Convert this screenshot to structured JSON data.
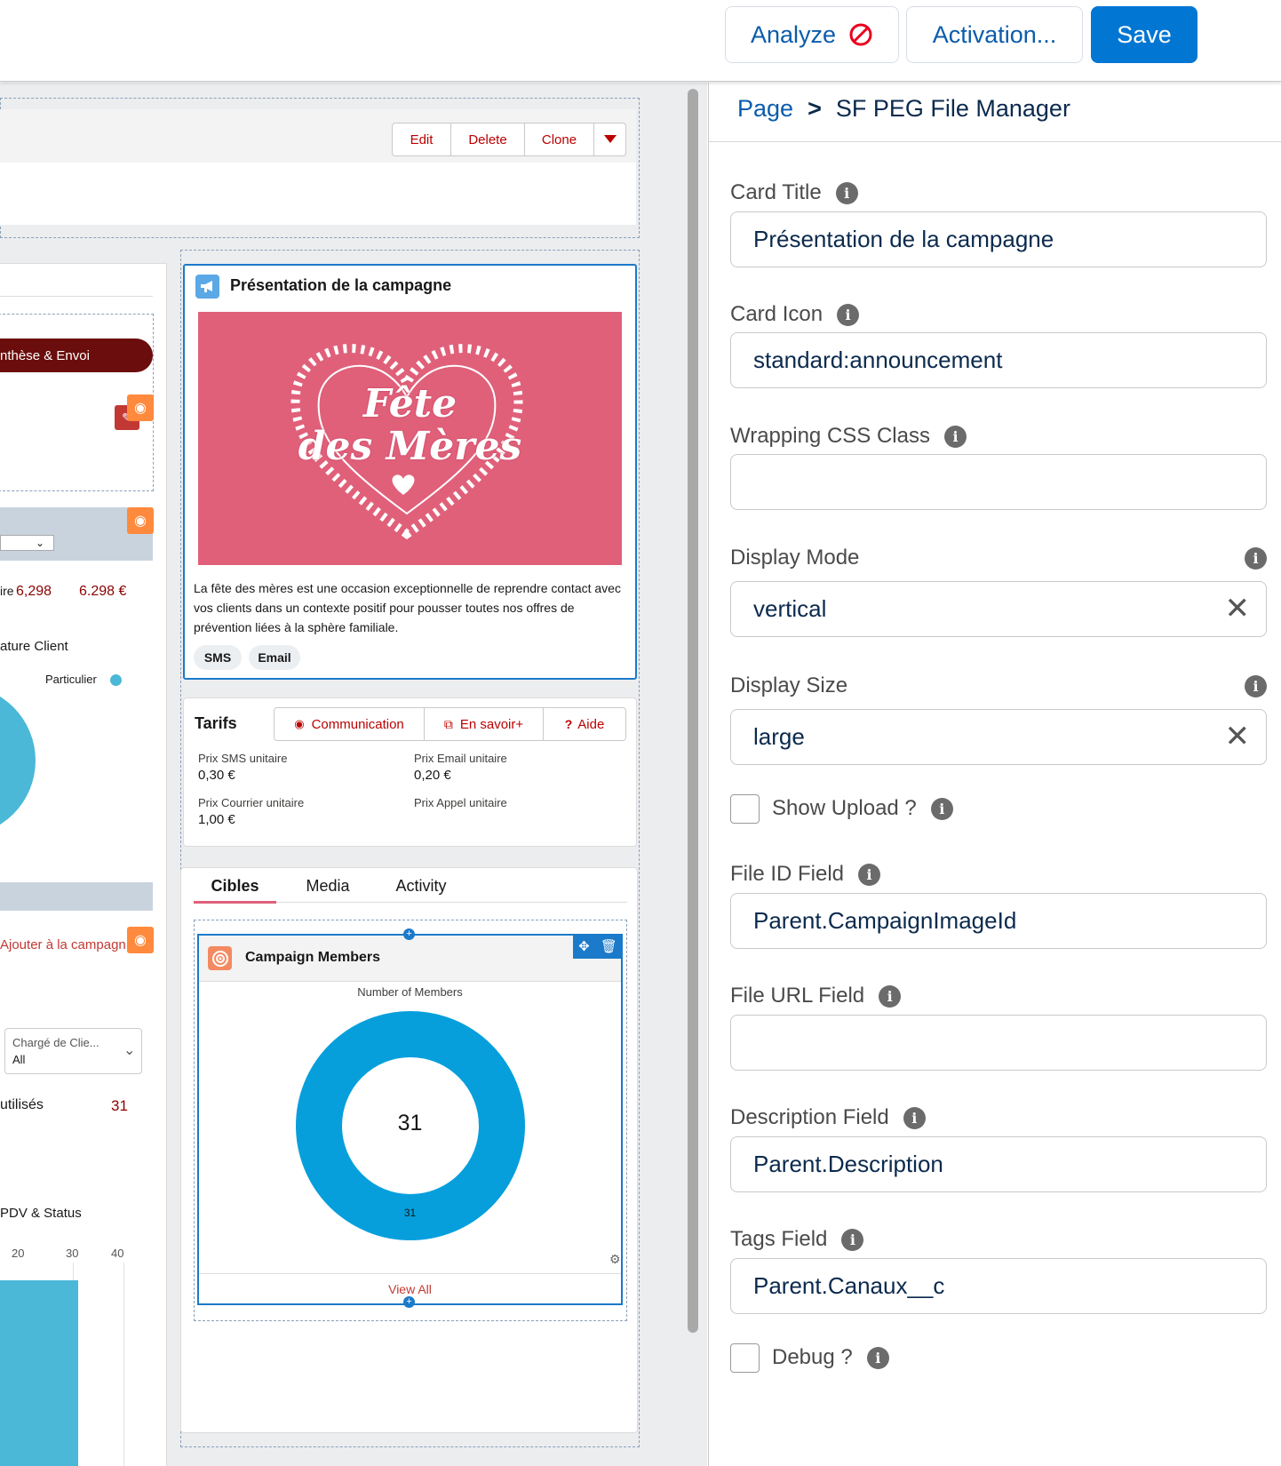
{
  "toolbar": {
    "analyze_label": "Analyze",
    "activation_label": "Activation...",
    "save_label": "Save"
  },
  "record_actions": {
    "edit": "Edit",
    "delete": "Delete",
    "clone": "Clone"
  },
  "left_column": {
    "path_step": "nthèse & Envoi",
    "amount_label": "ire",
    "amount_value": "6,298",
    "amount_currency": "6.298 €",
    "chart_title": "ature Client",
    "legend_label": "Particulier",
    "add_to_campaign": "Ajouter à la campagn",
    "filter_label": "Chargé de Clie...",
    "filter_value": "All",
    "used_label": "utilisés",
    "used_value": "31",
    "bar_chart_title": "PDV & Status",
    "axis_ticks": [
      "20",
      "30",
      "40"
    ]
  },
  "presentation": {
    "title": "Présentation de la campagne",
    "image_text_line1": "Fête",
    "image_text_line2": "des Mères",
    "description": "La fête des mères est une occasion exceptionnelle de reprendre contact avec vos clients dans un contexte positif pour pousser toutes nos offres de prévention liées à la sphère familiale.",
    "tags": [
      "SMS",
      "Email"
    ],
    "colors": {
      "image_bg": "#e0607a"
    }
  },
  "tarifs": {
    "title": "Tarifs",
    "actions": [
      "Communication",
      "En savoir+",
      "Aide"
    ],
    "fields": [
      {
        "label": "Prix SMS unitaire",
        "value": "0,30 €"
      },
      {
        "label": "Prix Email unitaire",
        "value": "0,20 €"
      },
      {
        "label": "Prix Courrier unitaire",
        "value": "1,00 €"
      },
      {
        "label": "Prix Appel unitaire",
        "value": ""
      }
    ]
  },
  "tabs": {
    "items": [
      "Cibles",
      "Media",
      "Activity"
    ],
    "active": "Cibles"
  },
  "campaign_members": {
    "title": "Campaign Members",
    "chart_subtitle": "Number of Members",
    "center_value": "31",
    "segment_label": "31",
    "view_all": "View All",
    "colors": {
      "donut": "#069fdc"
    }
  },
  "chart_data": {
    "type": "pie",
    "title": "Number of Members",
    "categories": [
      ""
    ],
    "values": [
      31
    ],
    "total": 31
  },
  "panel": {
    "breadcrumb_root": "Page",
    "breadcrumb_sep": ">",
    "breadcrumb_current": "SF PEG File Manager",
    "fields": {
      "card_title": {
        "label": "Card Title",
        "value": "Présentation de la campagne"
      },
      "card_icon": {
        "label": "Card Icon",
        "value": "standard:announcement"
      },
      "wrapping_css": {
        "label": "Wrapping CSS Class",
        "value": ""
      },
      "display_mode": {
        "label": "Display Mode",
        "value": "vertical"
      },
      "display_size": {
        "label": "Display Size",
        "value": "large"
      },
      "show_upload": {
        "label": "Show Upload ?"
      },
      "file_id": {
        "label": "File ID Field",
        "value": "Parent.CampaignImageId"
      },
      "file_url": {
        "label": "File URL Field",
        "value": ""
      },
      "description": {
        "label": "Description Field",
        "value": "Parent.Description"
      },
      "tags": {
        "label": "Tags Field",
        "value": "Parent.Canaux__c"
      },
      "debug": {
        "label": "Debug ?"
      }
    }
  }
}
